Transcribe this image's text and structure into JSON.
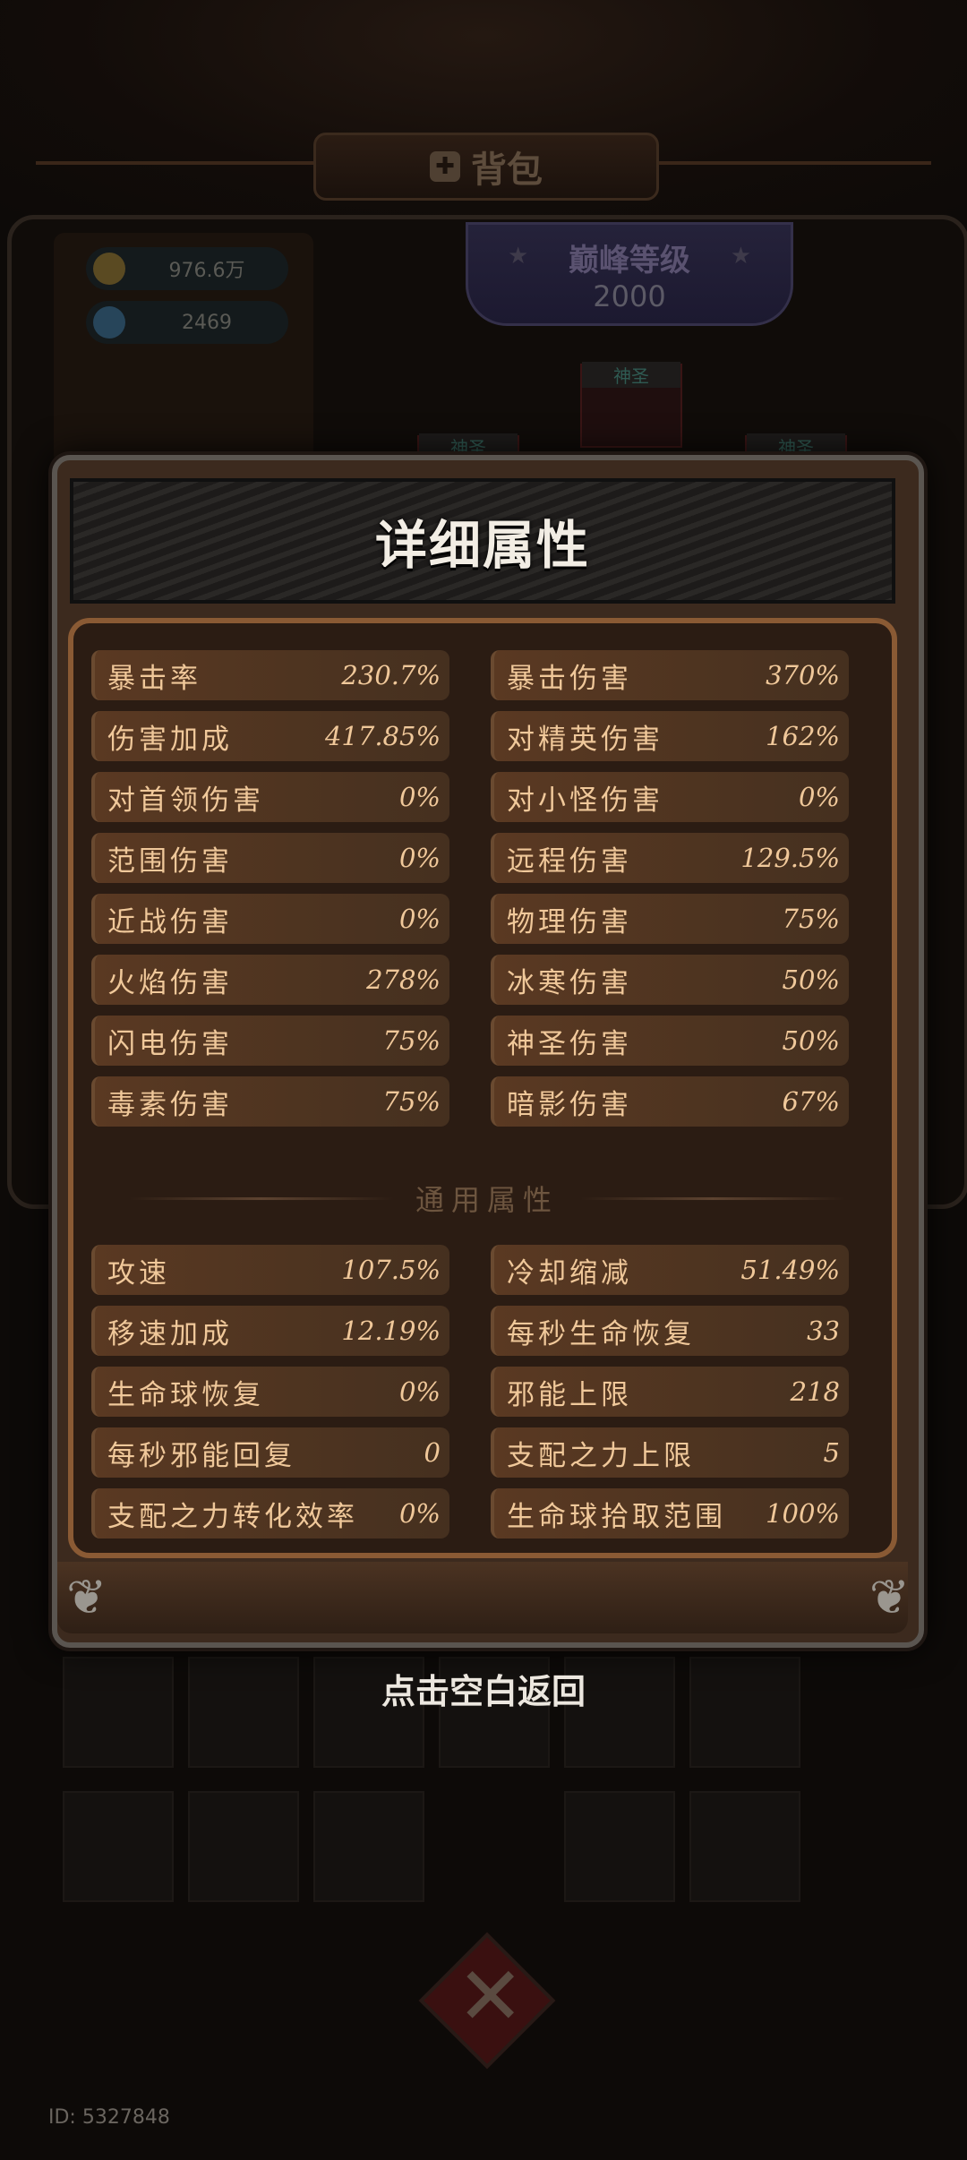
{
  "background": {
    "bag_title": "背包",
    "gold": "976.6万",
    "gems": "2469",
    "peak_level_title": "巅峰等级",
    "peak_level_value": "2000",
    "slot_labels": [
      "神圣",
      "神圣",
      "神圣"
    ],
    "user_id": "ID: 5327848"
  },
  "modal": {
    "title": "详细属性",
    "section_general": "通用属性",
    "stats": [
      {
        "name": "暴击率",
        "value": "230.7%"
      },
      {
        "name": "暴击伤害",
        "value": "370%"
      },
      {
        "name": "伤害加成",
        "value": "417.85%"
      },
      {
        "name": "对精英伤害",
        "value": "162%"
      },
      {
        "name": "对首领伤害",
        "value": "0%"
      },
      {
        "name": "对小怪伤害",
        "value": "0%"
      },
      {
        "name": "范围伤害",
        "value": "0%"
      },
      {
        "name": "远程伤害",
        "value": "129.5%"
      },
      {
        "name": "近战伤害",
        "value": "0%"
      },
      {
        "name": "物理伤害",
        "value": "75%"
      },
      {
        "name": "火焰伤害",
        "value": "278%"
      },
      {
        "name": "冰寒伤害",
        "value": "50%"
      },
      {
        "name": "闪电伤害",
        "value": "75%"
      },
      {
        "name": "神圣伤害",
        "value": "50%"
      },
      {
        "name": "毒素伤害",
        "value": "75%"
      },
      {
        "name": "暗影伤害",
        "value": "67%"
      }
    ],
    "general_stats": [
      {
        "name": "攻速",
        "value": "107.5%"
      },
      {
        "name": "冷却缩减",
        "value": "51.49%"
      },
      {
        "name": "移速加成",
        "value": "12.19%"
      },
      {
        "name": "每秒生命恢复",
        "value": "33"
      },
      {
        "name": "生命球恢复",
        "value": "0%"
      },
      {
        "name": "邪能上限",
        "value": "218"
      },
      {
        "name": "每秒邪能回复",
        "value": "0"
      },
      {
        "name": "支配之力上限",
        "value": "5"
      },
      {
        "name": "支配之力转化效率",
        "value": "0%"
      },
      {
        "name": "生命球拾取范围",
        "value": "100%"
      }
    ]
  },
  "back_hint": "点击空白返回",
  "colors": {
    "accent_gold": "#f0c89a",
    "modal_body": "#2b1c13",
    "stat_row": "#5a3922"
  }
}
